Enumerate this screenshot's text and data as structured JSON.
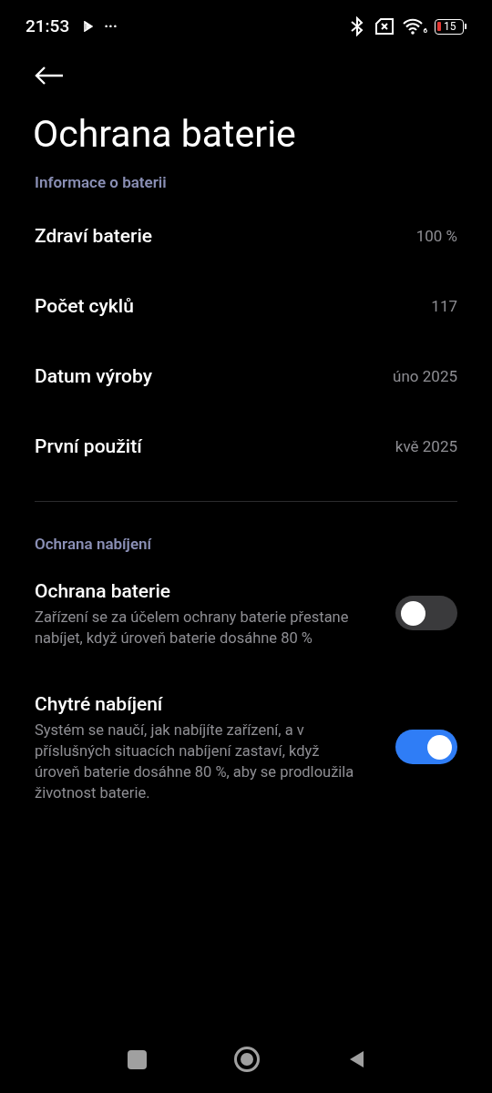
{
  "status_bar": {
    "time": "21:53",
    "more": "···",
    "wifi_badge": "6",
    "battery": "15"
  },
  "title": "Ochrana baterie",
  "sections": [
    {
      "header": "Informace o baterii",
      "items": [
        {
          "kind": "info",
          "label": "Zdraví baterie",
          "value": "100 %"
        },
        {
          "kind": "info",
          "label": "Počet cyklů",
          "value": "117"
        },
        {
          "kind": "info",
          "label": "Datum výroby",
          "value": "úno 2025"
        },
        {
          "kind": "info",
          "label": "První použití",
          "value": "kvě 2025"
        }
      ]
    },
    {
      "header": "Ochrana nabíjení",
      "items": [
        {
          "kind": "toggle",
          "label": "Ochrana baterie",
          "description": "Zařízení se za účelem ochrany baterie přestane nabíjet, když úroveň baterie dosáhne 80 %",
          "on": false
        },
        {
          "kind": "toggle",
          "label": "Chytré nabíjení",
          "description": "Systém se naučí, jak nabíjíte zařízení, a v příslušných situacích nabíjení zastaví, když úroveň baterie dosáhne 80 %, aby se prodloužila životnost baterie.",
          "on": true
        }
      ]
    }
  ]
}
